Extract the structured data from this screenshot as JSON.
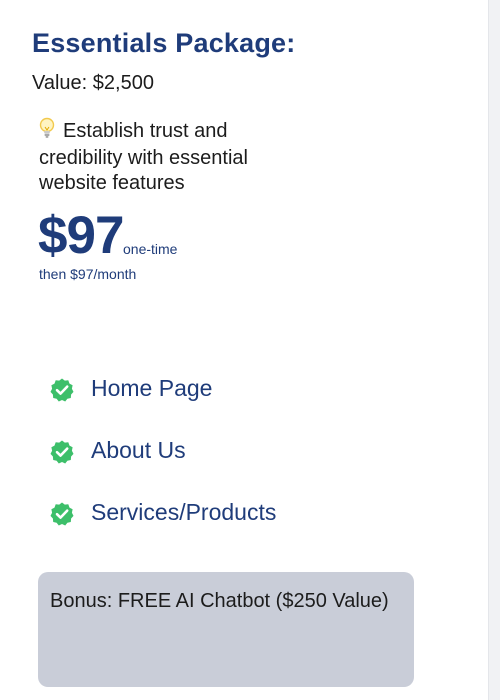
{
  "package": {
    "title": "Essentials Package:",
    "value_text": "Value: $2,500",
    "tagline": "Establish trust and credibility with essential website features",
    "tagline_icon": "lightbulb-icon"
  },
  "pricing": {
    "price": "$97",
    "price_suffix": "one-time",
    "then_text": "then $97/month"
  },
  "features": [
    {
      "label": "Home Page",
      "icon": "check-badge-icon"
    },
    {
      "label": "About Us",
      "icon": "check-badge-icon"
    },
    {
      "label": "Services/Products",
      "icon": "check-badge-icon"
    }
  ],
  "bonus": {
    "text": "Bonus: FREE AI Chatbot ($250 Value)"
  },
  "colors": {
    "heading": "#1f3c7a",
    "check": "#3dbf6a",
    "bonus_bg": "#c9cdd8"
  }
}
